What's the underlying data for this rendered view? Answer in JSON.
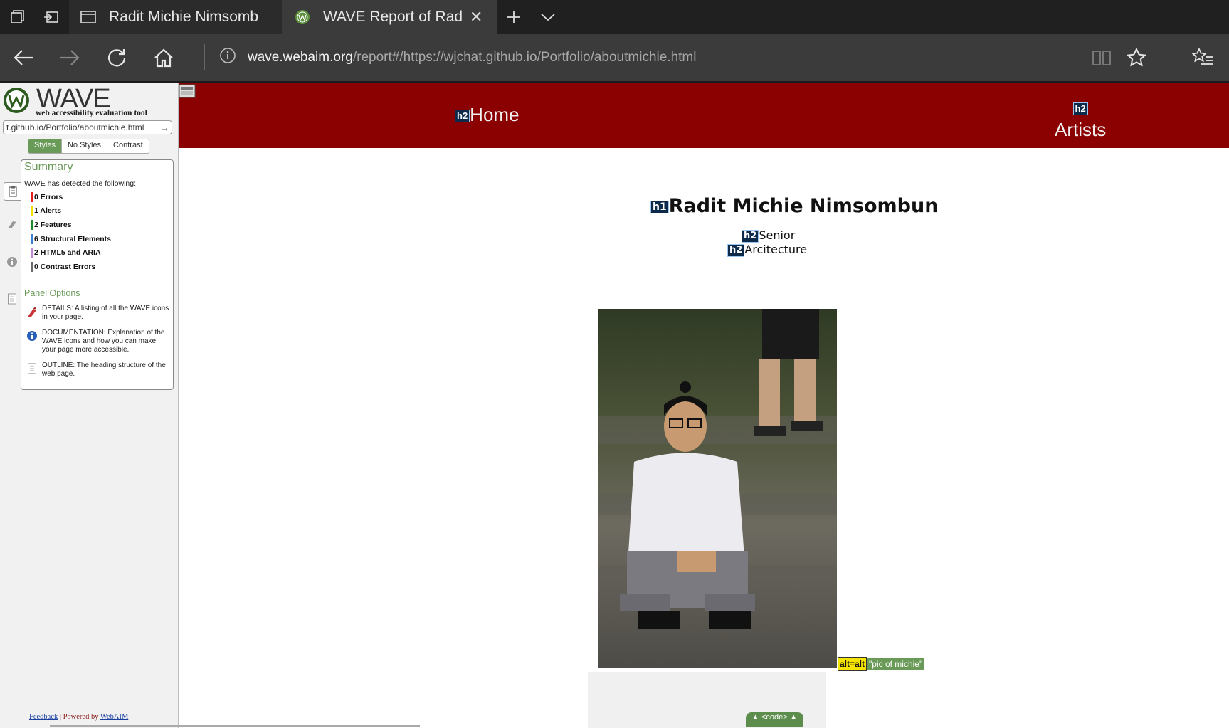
{
  "browser": {
    "tabs": [
      {
        "title": "Radit Michie Nimsombun",
        "active": false
      },
      {
        "title": "WAVE Report of Radit M",
        "active": true
      }
    ],
    "address": {
      "host": "wave.webaim.org",
      "path": "/report#/https://wjchat.github.io/Portfolio/aboutmichie.html"
    }
  },
  "wave": {
    "logo_title": "WAVE",
    "logo_subtitle": "web accessibility evaluation tool",
    "url_value": "t.github.io/Portfolio/aboutmichie.html",
    "style_tabs": [
      "Styles",
      "No Styles",
      "Contrast"
    ],
    "summary_title": "Summary",
    "detected_text": "WAVE has detected the following:",
    "counts": [
      {
        "label": "0 Errors",
        "color": "#e31b1b"
      },
      {
        "label": "1 Alerts",
        "color": "#f2e100"
      },
      {
        "label": "2 Features",
        "color": "#1c8a2a"
      },
      {
        "label": "6 Structural Elements",
        "color": "#3a7fd0"
      },
      {
        "label": "2 HTML5 and ARIA",
        "color": "#c08ad0"
      },
      {
        "label": "0 Contrast Errors",
        "color": "#6a6a6a"
      }
    ],
    "panel_options_title": "Panel Options",
    "options": [
      {
        "text": "DETAILS: A listing of all the WAVE icons in your page.",
        "icon": "details-flag-icon"
      },
      {
        "text": "DOCUMENTATION: Explanation of the WAVE icons and how you can make your page more accessible.",
        "icon": "info-icon"
      },
      {
        "text": "OUTLINE: The heading structure of the web page.",
        "icon": "outline-doc-icon"
      }
    ],
    "footer": {
      "feedback": "Feedback",
      "sep": " | Powered by ",
      "webaim": "WebAIM"
    }
  },
  "page": {
    "nav": {
      "home": "Home",
      "artists": "Artists"
    },
    "h1": "Radit Michie Nimsombun",
    "h2_senior": "Senior",
    "h2_arch": "Arcitecture",
    "tags": {
      "h1": "h1",
      "h2": "h2"
    },
    "alt_flag": "alt=alt",
    "alt_text": "\"pic of michie\"",
    "code_button": "▲ <code> ▲"
  }
}
